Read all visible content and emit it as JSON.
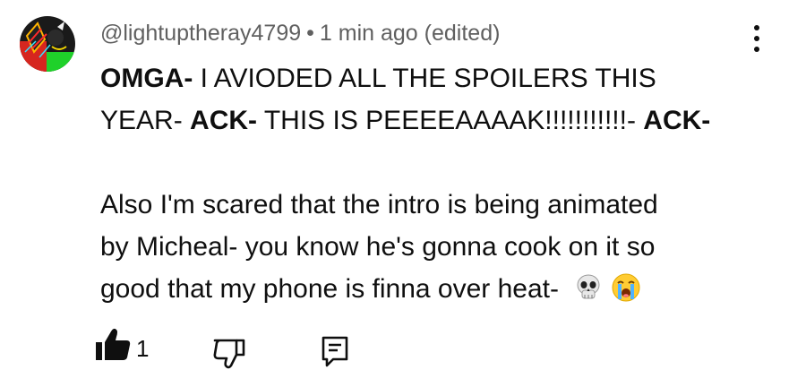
{
  "comment": {
    "username": "@lightuptheray4799",
    "separator": "•",
    "timestamp": "1 min ago (edited)",
    "avatar_icon": "avatar-image",
    "lines": {
      "l1_bold": "OMGA-",
      "l1_rest": " I AVIODED ALL THE SPOILERS THIS",
      "l2_start": "YEAR- ",
      "l2_bold1": "ACK-",
      "l2_mid": " THIS IS PEEEEAAAAK!!!!!!!!!!!- ",
      "l2_bold2": "ACK-",
      "l3": "Also I'm scared that the intro is being animated",
      "l4": "by Micheal- you know he's gonna cook on it so",
      "l5": "good that my phone is finna over heat- "
    },
    "emojis": [
      "skull-emoji",
      "loudly-crying-emoji"
    ]
  },
  "actions": {
    "like_count": "1",
    "like_icon": "thumbs-up-filled-icon",
    "dislike_icon": "thumbs-down-icon",
    "reply_icon": "reply-comment-icon",
    "menu_icon": "more-vertical-icon"
  }
}
